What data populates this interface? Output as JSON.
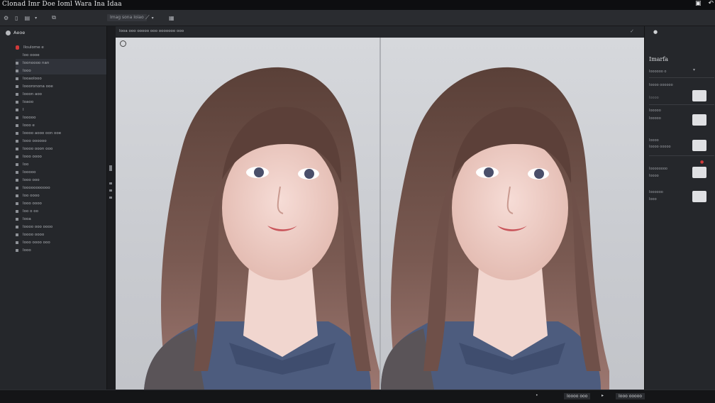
{
  "app": {
    "title": "Clonad Imr Doe Ioml Wara Ina Idaa"
  },
  "toolbar": {
    "zoom_label": "Imag sona Ioiao"
  },
  "left_panel": {
    "header": "Aeoe",
    "items": [
      "Iloulome e",
      "Ioo oooe",
      "Ioonoooo nan",
      "Iooo",
      "Iooaolooo",
      "Ioooronona ooe",
      "Iooon aoo",
      "Ioaoo",
      "I",
      "Iooooo",
      "Iooo e",
      "Ioooo aooo oon ooe",
      "Iooo oooooo",
      "Ioooo ooon ooo",
      "Iooo oooo",
      "Ioo",
      "Iooooo",
      "Iooo ooo",
      "Iooooooooooo",
      "Ioo oooo",
      "Iooo oooo",
      "Ioo o oo",
      "Iooa",
      "Ioooo ooo oooo",
      "Ioooo oooo",
      "Iooo oooo ooo",
      "Iooo"
    ]
  },
  "canvas": {
    "header": "Iooa ooo ooooo ooo ooooooo ooo"
  },
  "right_panel": {
    "title": "Imarfa",
    "sections": [
      {
        "label": "Ioooooo o",
        "sublabel": ""
      },
      {
        "label": "Ioooo oooooo",
        "sublabel": "Ioooo"
      },
      {
        "label": "Iooooo",
        "sublabel": "Iooooo"
      },
      {
        "label": "Ioooo",
        "sublabel": "Ioooo ooooo"
      },
      {
        "label": "Ioooooooo",
        "sublabel": "Ioooo"
      },
      {
        "label": "Ioooooo",
        "sublabel": "Iooo"
      }
    ]
  },
  "status_bar": {
    "left_text": "Ioooo ooo",
    "right_text": "Iooo ooooo"
  }
}
